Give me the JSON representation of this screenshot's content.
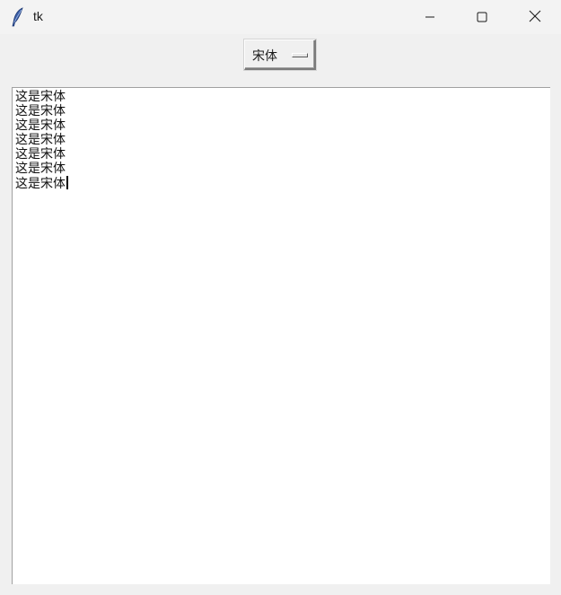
{
  "window": {
    "title": "tk",
    "icon": "feather-icon",
    "controls": {
      "minimize_icon": "minimize-icon",
      "maximize_icon": "maximize-icon",
      "close_icon": "close-icon"
    }
  },
  "toolbar": {
    "font_menubutton": {
      "label": "宋体",
      "indicator": "option-menu-indicator"
    }
  },
  "editor": {
    "lines": [
      "这是宋体",
      "这是宋体",
      "这是宋体",
      "这是宋体",
      "这是宋体",
      "这是宋体",
      "这是宋体"
    ]
  },
  "colors": {
    "window_bg": "#f0f0f0",
    "titlebar_bg": "#f3f3f3",
    "text_bg": "#ffffff",
    "text_color": "#111111"
  }
}
